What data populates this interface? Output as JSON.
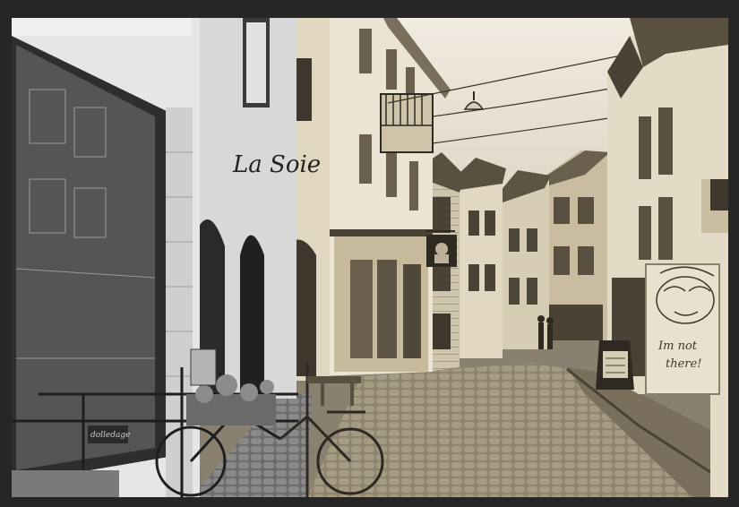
{
  "scene": {
    "subject": "street-photograph",
    "tone_left": "grayscale",
    "tone_right": "sepia",
    "colors": {
      "frame": "#262626",
      "sky": "#ece6d8",
      "sepia_light": "#e6dcc6",
      "sepia_mid": "#b9ac92",
      "sepia_dark": "#4a4234",
      "gray_light": "#d4d4d4",
      "gray_dark": "#2e2e2e"
    }
  },
  "signs": {
    "shop_script": "La Soie",
    "graffiti_line1": "Im not",
    "graffiti_line2": "there!",
    "window_logo": "dolledage"
  }
}
